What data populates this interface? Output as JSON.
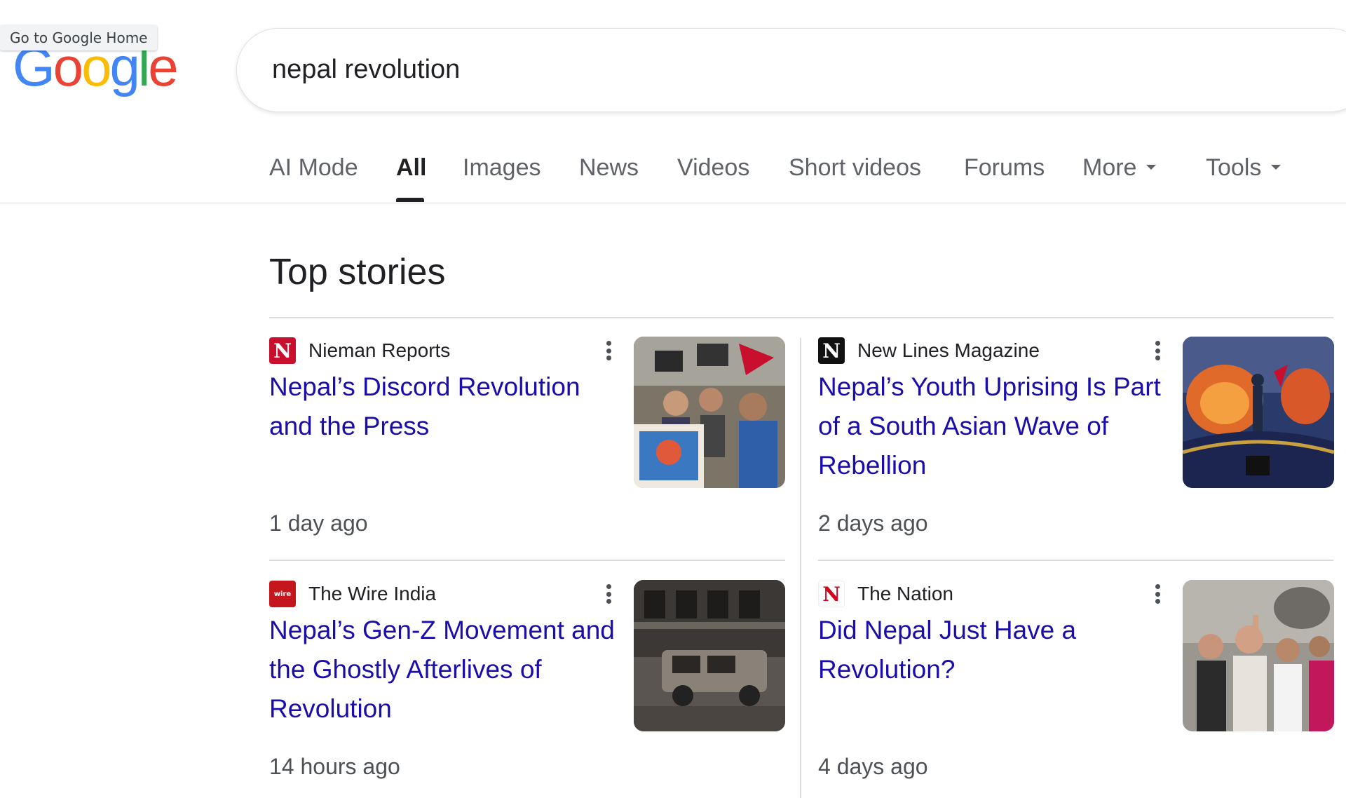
{
  "tooltip": "Go to Google Home",
  "logo": {
    "letters": [
      "G",
      "o",
      "o",
      "g",
      "l",
      "e"
    ],
    "colors": [
      "#4285f4",
      "#ea4335",
      "#fbbc05",
      "#4285f4",
      "#34a853",
      "#ea4335"
    ]
  },
  "search": {
    "value": "nepal revolution"
  },
  "tabs": [
    {
      "label": "AI Mode"
    },
    {
      "label": "All",
      "active": true
    },
    {
      "label": "Images"
    },
    {
      "label": "News"
    },
    {
      "label": "Videos"
    },
    {
      "label": "Short videos"
    },
    {
      "label": "Forums"
    },
    {
      "label": "More",
      "dropdown": true
    },
    {
      "label": "Tools",
      "dropdown": true
    }
  ],
  "top_stories": {
    "heading": "Top stories",
    "stories": [
      {
        "source": "Nieman Reports",
        "favicon_icon": "nieman-reports-logo-icon",
        "favicon_color": "#c8102e",
        "title": "Nepal’s Discord Revolution and the Press",
        "time": "1 day ago",
        "image": "protest-crowd-flags-image"
      },
      {
        "source": "New Lines Magazine",
        "favicon_icon": "new-lines-logo-icon",
        "favicon_color": "#111111",
        "title": "Nepal’s Youth Uprising Is Part of a South Asian Wave of Rebellion",
        "time": "2 days ago",
        "image": "fire-gate-protester-image"
      },
      {
        "source": "The Wire India",
        "favicon_icon": "the-wire-logo-icon",
        "favicon_color": "#c4161c",
        "title": "Nepal’s Gen-Z Movement and the Ghostly Afterlives of Revolution",
        "time": "14 hours ago",
        "image": "burned-building-car-image"
      },
      {
        "source": "The Nation",
        "favicon_icon": "the-nation-logo-icon",
        "favicon_color": "#d6001c",
        "title": "Did Nepal Just Have a Revolution?",
        "time": "4 days ago",
        "image": "celebrating-crowd-image"
      }
    ]
  }
}
